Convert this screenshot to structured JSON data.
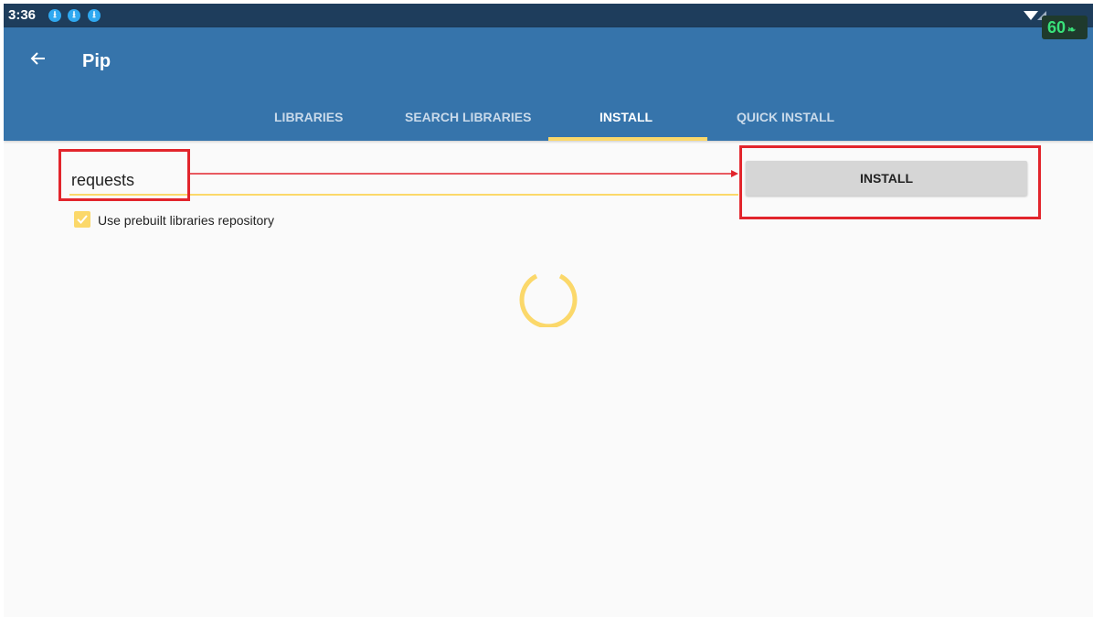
{
  "status_bar": {
    "time": "3:36",
    "notification_icons": [
      "download-icon",
      "download-icon",
      "download-icon"
    ],
    "fps": "60"
  },
  "app_bar": {
    "title": "Pip",
    "tabs": [
      {
        "label": "LIBRARIES",
        "active": false
      },
      {
        "label": "SEARCH LIBRARIES",
        "active": false
      },
      {
        "label": "INSTALL",
        "active": true
      },
      {
        "label": "QUICK INSTALL",
        "active": false
      }
    ]
  },
  "install_form": {
    "package_value": "requests",
    "install_button_label": "INSTALL",
    "prebuilt_checkbox_label": "Use prebuilt libraries repository",
    "prebuilt_checked": true
  },
  "colors": {
    "app_bar": "#3674ab",
    "status_bar": "#1e3d5c",
    "accent": "#fbd86a",
    "annotation": "#e2252c"
  }
}
